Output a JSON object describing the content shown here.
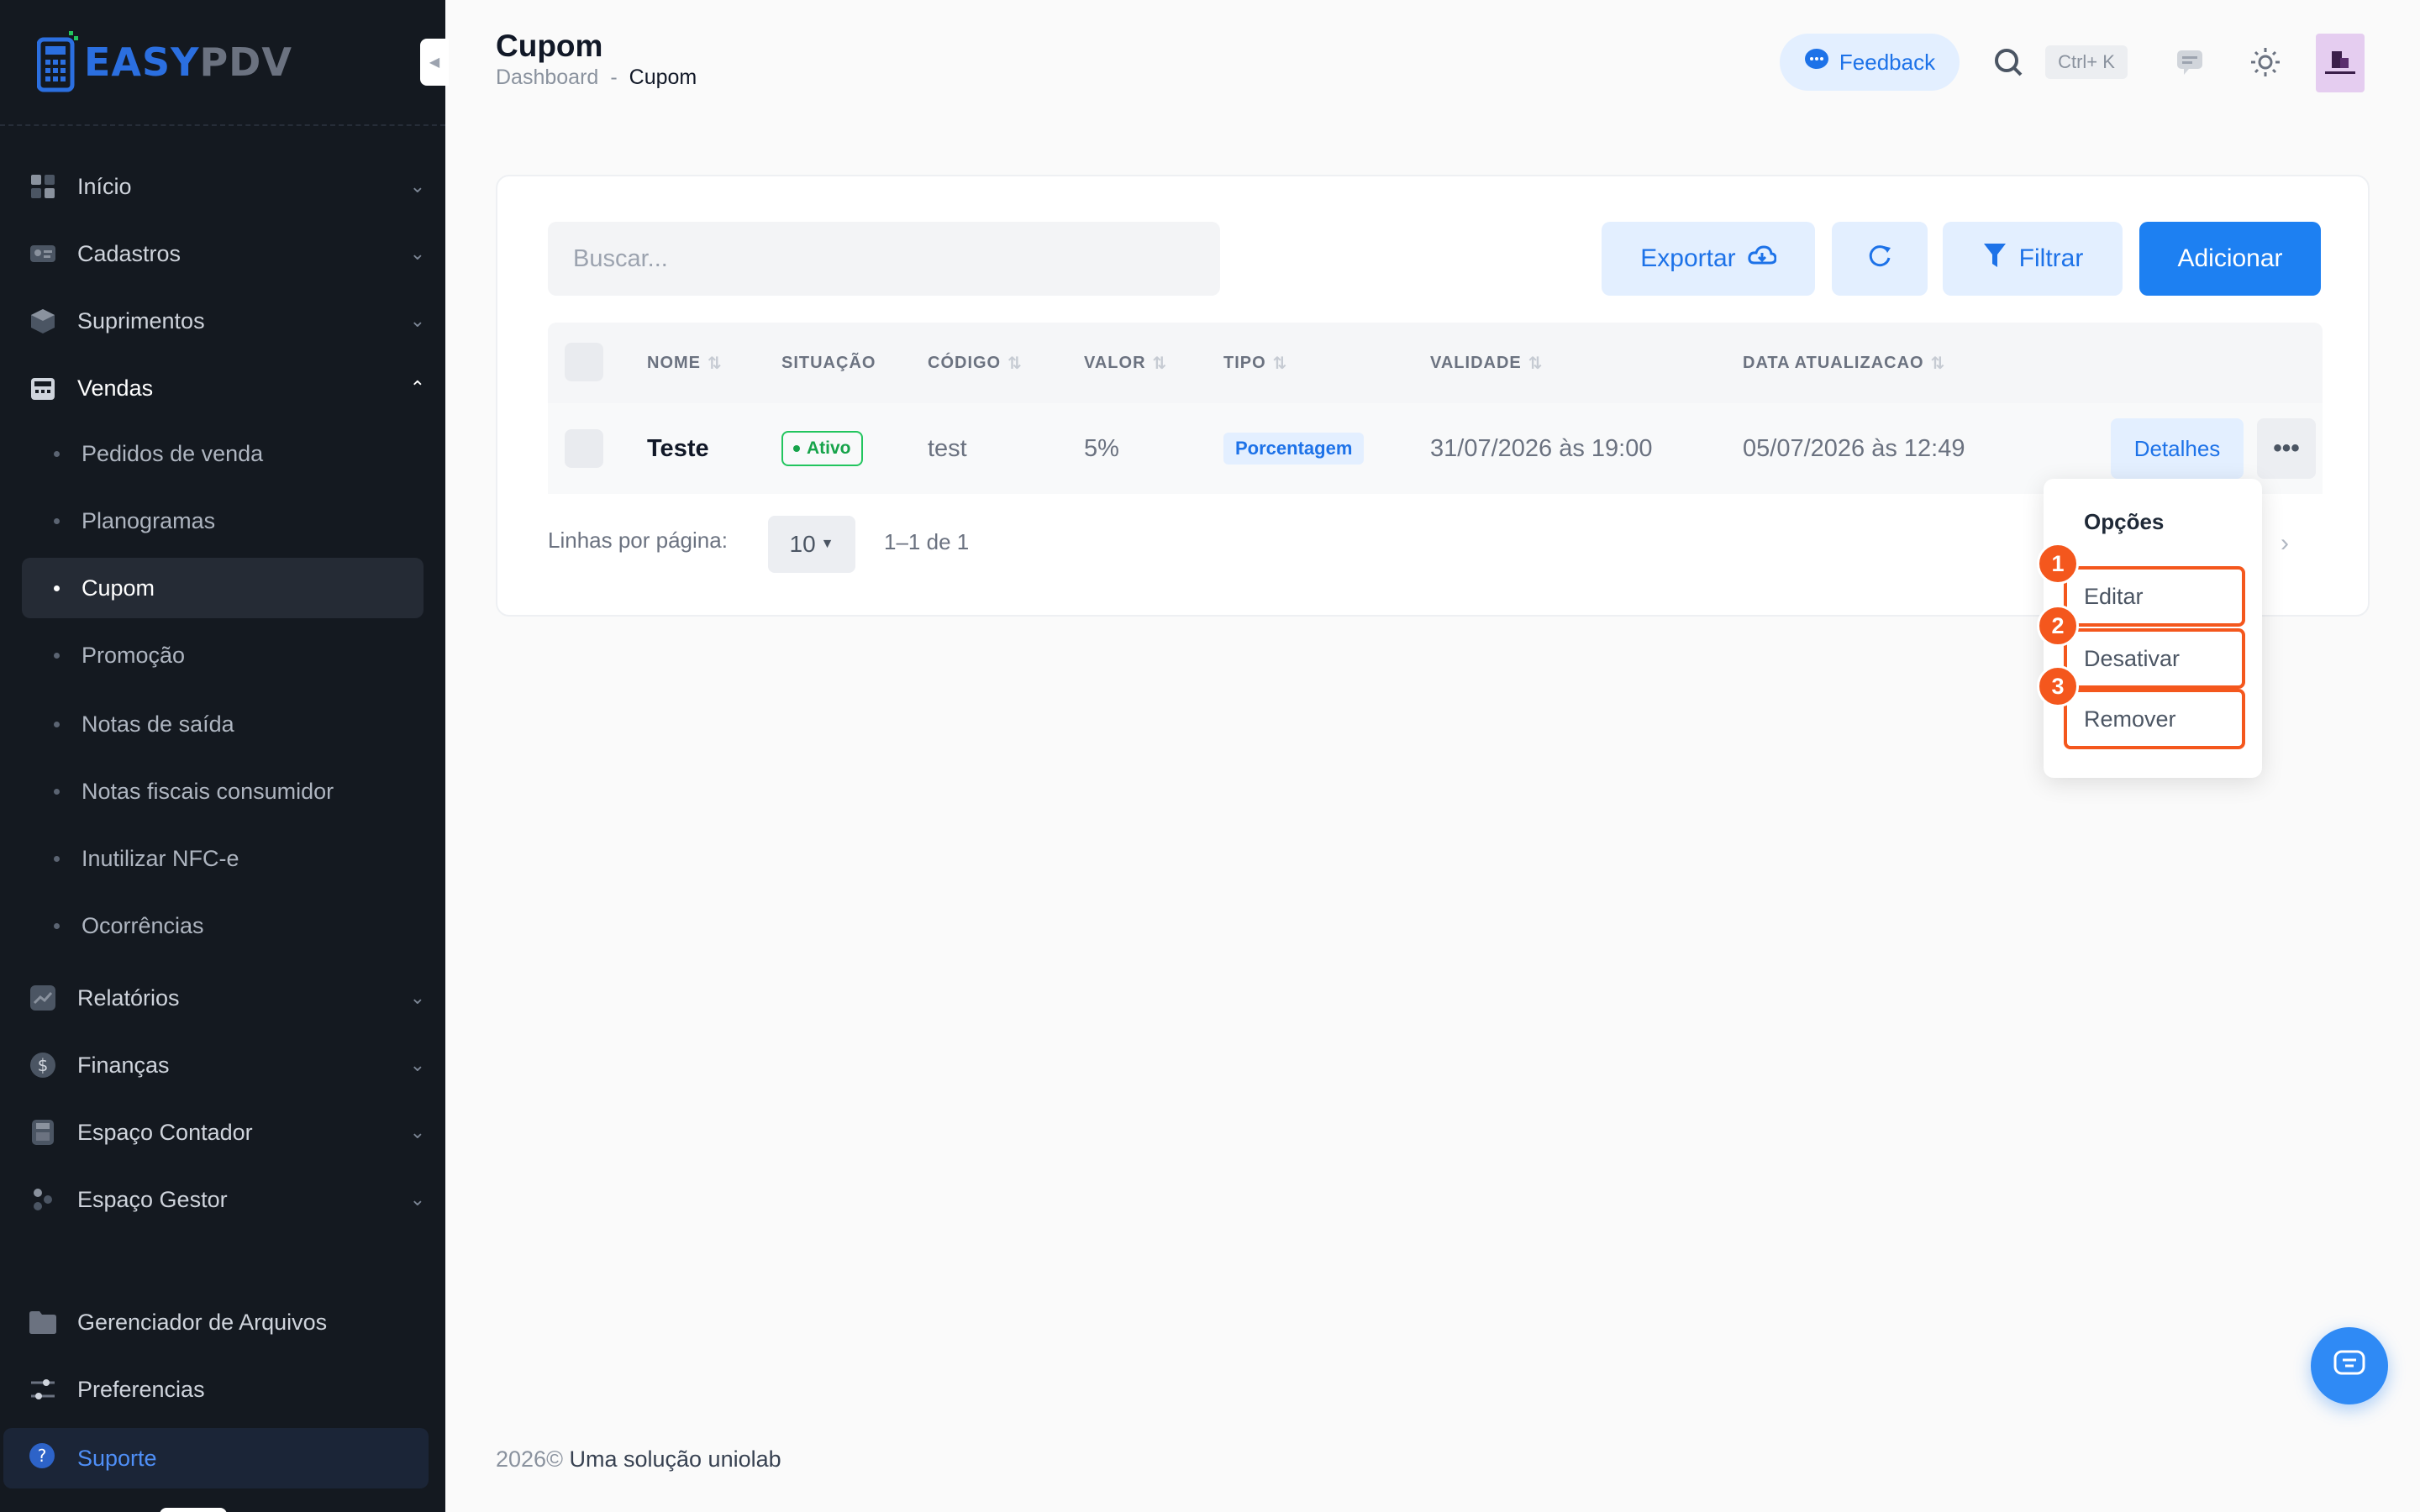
{
  "brand": {
    "logo_part1": "EASY",
    "logo_part2": "PDV"
  },
  "sidebar": {
    "groups": [
      {
        "label": "Início",
        "icon": "grid-icon"
      },
      {
        "label": "Cadastros",
        "icon": "id-card-icon"
      },
      {
        "label": "Suprimentos",
        "icon": "box-icon"
      },
      {
        "label": "Vendas",
        "icon": "register-icon",
        "expanded": true
      }
    ],
    "vendas_items": [
      {
        "label": "Pedidos de venda"
      },
      {
        "label": "Planogramas"
      },
      {
        "label": "Cupom",
        "active": true
      },
      {
        "label": "Promoção"
      },
      {
        "label": "Notas de saída"
      },
      {
        "label": "Notas fiscais consumidor"
      },
      {
        "label": "Inutilizar NFC-e"
      },
      {
        "label": "Ocorrências"
      }
    ],
    "groups2": [
      {
        "label": "Relatórios",
        "icon": "chart-icon"
      },
      {
        "label": "Finanças",
        "icon": "dollar-icon"
      },
      {
        "label": "Espaço Contador",
        "icon": "calculator-icon"
      },
      {
        "label": "Espaço Gestor",
        "icon": "people-icon"
      }
    ],
    "bottom": [
      {
        "label": "Gerenciador de Arquivos",
        "icon": "folder-icon"
      },
      {
        "label": "Preferencias",
        "icon": "sliders-icon"
      }
    ],
    "support_label": "Suporte"
  },
  "header": {
    "title": "Cupom",
    "breadcrumb": [
      "Dashboard",
      "-",
      "Cupom"
    ],
    "feedback_label": "Feedback",
    "shortcut": "Ctrl+ K"
  },
  "toolbar": {
    "search_placeholder": "Buscar...",
    "export_label": "Exportar",
    "filter_label": "Filtrar",
    "add_label": "Adicionar"
  },
  "table": {
    "columns": [
      "NOME",
      "SITUAÇÃO",
      "CÓDIGO",
      "VALOR",
      "TIPO",
      "VALIDADE",
      "DATA ATUALIZACAO"
    ],
    "rows": [
      {
        "nome": "Teste",
        "situacao": "Ativo",
        "codigo": "test",
        "valor": "5%",
        "tipo": "Porcentagem",
        "validade": "31/07/2026 às 19:00",
        "data_atualizacao": "05/07/2026 às 12:49",
        "details_label": "Detalhes"
      }
    ]
  },
  "pagination": {
    "rows_label": "Linhas por página:",
    "rows_value": "10",
    "range": "1–1 de 1"
  },
  "dropdown": {
    "title": "Opções",
    "items": [
      {
        "marker": "1",
        "label": "Editar"
      },
      {
        "marker": "2",
        "label": "Desativar"
      },
      {
        "marker": "3",
        "label": "Remover"
      }
    ]
  },
  "footer": {
    "year": "2026©",
    "text": "Uma solução uniolab"
  },
  "colors": {
    "primary": "#1d80f2",
    "sidebar_bg": "#141920",
    "highlight": "#f4571d",
    "success": "#16a34a"
  }
}
